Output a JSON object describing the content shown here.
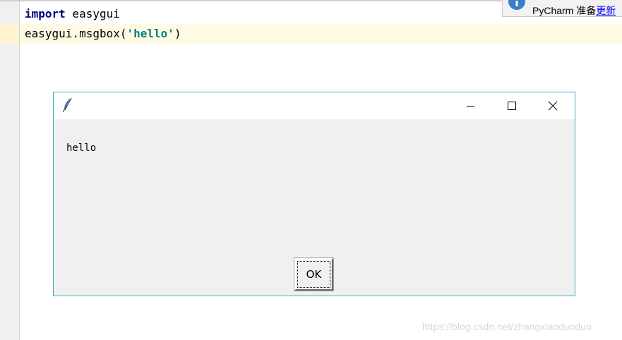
{
  "editor": {
    "lines": [
      {
        "keyword": "import",
        "rest": " easygui"
      },
      {
        "prefix": "easygui.msgbox(",
        "string": "'hello'",
        "suffix": ")"
      }
    ]
  },
  "notification": {
    "text": "PyCharm 准备",
    "link": "更新"
  },
  "dialog": {
    "message": "hello",
    "ok_label": "OK",
    "border_color": "#2fb3c2"
  },
  "watermark": "https://blog.csdn.net/zhangxiaoduoduo"
}
